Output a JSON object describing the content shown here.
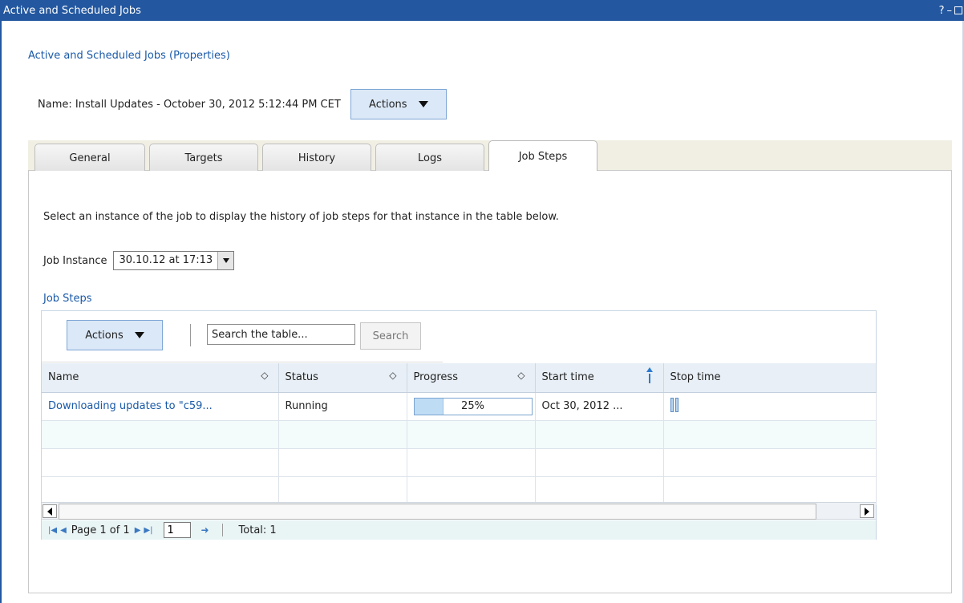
{
  "window": {
    "title": "Active and Scheduled Jobs",
    "controls": [
      "?",
      "–",
      "□"
    ]
  },
  "properties_link": "Active and Scheduled Jobs (Properties)",
  "job_name": "Name: Install Updates - October 30, 2012 5:12:44 PM CET",
  "actions_label": "Actions",
  "tabs": [
    {
      "label": "General",
      "active": false
    },
    {
      "label": "Targets",
      "active": false
    },
    {
      "label": "History",
      "active": false
    },
    {
      "label": "Logs",
      "active": false
    },
    {
      "label": "Job Steps",
      "active": true
    }
  ],
  "instructions": "Select an instance of the job to display the history of job steps for that instance in the table below.",
  "job_instance": {
    "label": "Job Instance",
    "value": "30.10.12 at 17:13"
  },
  "section_title": "Job Steps",
  "table_toolbar": {
    "actions_label": "Actions",
    "search_placeholder": "Search the table...",
    "search_button": "Search"
  },
  "columns": [
    "Name",
    "Status",
    "Progress",
    "Start time",
    "Stop time"
  ],
  "rows": [
    {
      "name": "Downloading updates to \"c59...",
      "status": "Running",
      "progress_percent": 25,
      "progress_label": "25%",
      "start_time": "Oct 30, 2012 ...",
      "stop_time_icon": "busy-indicator-icon"
    }
  ],
  "pager": {
    "page_text": "Page 1 of 1",
    "page_value": "1",
    "total_text": "Total: 1"
  },
  "colors": {
    "titlebar": "#23579f",
    "link": "#1a5aa8",
    "button_fill": "#dbe8f7",
    "progress_fill": "#bfdcf5"
  }
}
